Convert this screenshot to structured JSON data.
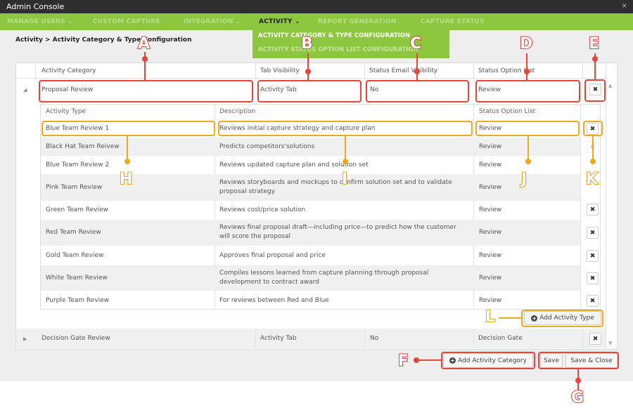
{
  "window": {
    "title": "Admin Console",
    "close": "×"
  },
  "nav": {
    "items": [
      {
        "label": "MANAGE USERS"
      },
      {
        "label": "CUSTOM CAPTURE"
      },
      {
        "label": "INTEGRATION"
      },
      {
        "label": "ACTIVITY"
      },
      {
        "label": "REPORT GENERATION"
      },
      {
        "label": "CAPTURE STATUS"
      }
    ],
    "chevron": "⌄"
  },
  "dropdown": {
    "items": [
      {
        "label": "ACTIVITY CATEGORY & TYPE CONFIGURATION"
      },
      {
        "label": "ACTIVITY STATUS OPTION LIST CONFIGURATION"
      }
    ]
  },
  "breadcrumb": "Activity > Activity Category & Type Configuration",
  "grid": {
    "headers": [
      "Activity Category",
      "Tab Visibility",
      "Status Email Visibility",
      "Status Option List"
    ],
    "categories": [
      {
        "name": "Proposal Review",
        "tab": "Activity Tab",
        "email": "No",
        "status": "Review"
      },
      {
        "name": "Decision Gate Review",
        "tab": "Activity Tab",
        "email": "No",
        "status": "Decision Gate"
      }
    ],
    "sub_headers": [
      "Activity Type",
      "Description",
      "Status Option List"
    ],
    "types": [
      {
        "name": "Blue Team Review 1",
        "desc": "Reviews initial capture strategy and capture plan",
        "status": "Review"
      },
      {
        "name": "Black Hat Team Reivew",
        "desc": "Predicts competitors'solutions",
        "status": "Review"
      },
      {
        "name": "Blue Team Review 2",
        "desc": "Reviews updated capture plan and solution set",
        "status": "Review"
      },
      {
        "name": "Pink Team Review",
        "desc": "Reviews storyboards and mockups to confirm solution set and to validate proposal strategy",
        "status": "Review"
      },
      {
        "name": "Green Team Review",
        "desc": "Reviews cost/price solution",
        "status": "Review"
      },
      {
        "name": "Red Team Review",
        "desc": "Reviews final proposal draft—including price—to predict how the customer will score the proposal",
        "status": "Review"
      },
      {
        "name": "Gold Team Review",
        "desc": "Approves final proposal and price",
        "status": "Review"
      },
      {
        "name": "White Team Review",
        "desc": "Compiles lessons learned from capture planning through proposal development to contract award",
        "status": "Review"
      },
      {
        "name": "Purple Team Review",
        "desc": "For reviews between Red and Blue",
        "status": "Review"
      }
    ],
    "delete_glyph": "✖",
    "add_type": "Add Activity Type"
  },
  "footer": {
    "add_category": "Add Activity Category",
    "save": "Save",
    "save_close": "Save & Close"
  },
  "callouts": [
    "A",
    "B",
    "C",
    "D",
    "E",
    "F",
    "G",
    "H",
    "I",
    "J",
    "K",
    "L"
  ],
  "colors": {
    "nav": "#8dc63f",
    "red_callout": "#e8443a",
    "orange_callout": "#f0a91c"
  }
}
